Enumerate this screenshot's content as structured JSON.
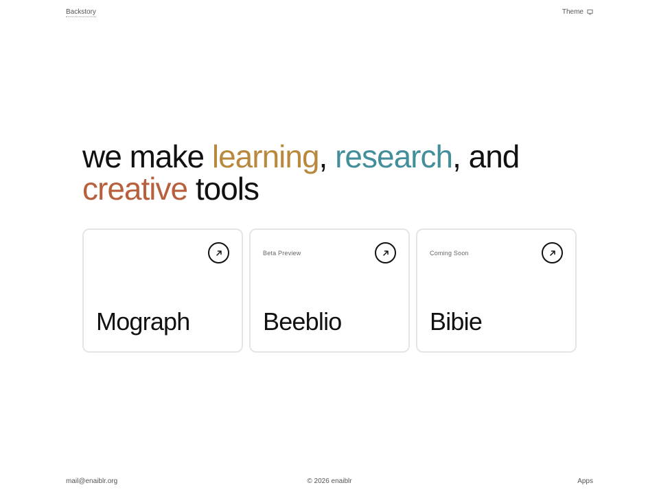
{
  "header": {
    "backstory_label": "Backstory",
    "theme_label": "Theme"
  },
  "hero": {
    "part1": "we make ",
    "word1": "learning",
    "sep1": ", ",
    "word2": "research",
    "sep2": ", and ",
    "word3": "creative",
    "part2": " tools"
  },
  "colors": {
    "learning": "#b8893d",
    "research": "#438e9b",
    "creative": "#b8603d"
  },
  "cards": [
    {
      "badge": "",
      "title": "Mograph",
      "icon": "arrow-up-right-icon"
    },
    {
      "badge": "Beta Preview",
      "title": "Beeblio",
      "icon": "arrow-up-right-icon"
    },
    {
      "badge": "Coming Soon",
      "title": "Bibie",
      "icon": "arrow-up-right-icon"
    }
  ],
  "footer": {
    "email": "mail@enaiblr.org",
    "copyright": "© 2026 enaiblr",
    "apps_label": "Apps"
  }
}
